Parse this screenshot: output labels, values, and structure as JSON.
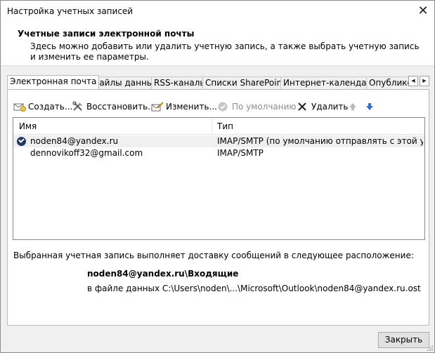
{
  "window": {
    "title": "Настройка учетных записей",
    "close_glyph": "✕"
  },
  "header": {
    "title": "Учетные записи электронной почты",
    "description": "Здесь можно добавить или удалить учетную запись, а также выбрать учетную запись и изменить ее параметры."
  },
  "tabs": [
    {
      "label": "Электронная почта",
      "active": true
    },
    {
      "label": "Файлы данных",
      "active": false
    },
    {
      "label": "RSS-каналы",
      "active": false
    },
    {
      "label": "Списки SharePoint",
      "active": false
    },
    {
      "label": "Интернет-календари",
      "active": false
    },
    {
      "label": "Опублико",
      "active": false
    }
  ],
  "toolbar": {
    "create": "Создать...",
    "restore": "Восстановить...",
    "edit": "Изменить...",
    "default": "По умолчанию",
    "delete": "Удалить"
  },
  "list": {
    "columns": {
      "name": "Имя",
      "type": "Тип"
    },
    "rows": [
      {
        "name": "noden84@yandex.ru",
        "type": "IMAP/SMTP (по умолчанию отправлять с этой уче...",
        "default": true,
        "selected": true
      },
      {
        "name": "dennovikoff32@gmail.com",
        "type": "IMAP/SMTP",
        "default": false,
        "selected": false
      }
    ]
  },
  "delivery": {
    "label": "Выбранная учетная запись выполняет доставку сообщений в следующее расположение:",
    "folder": "noden84@yandex.ru\\Входящие",
    "path": "в файле данных C:\\Users\\noden\\...\\Microsoft\\Outlook\\noden84@yandex.ru.ost"
  },
  "buttons": {
    "close": "Закрыть"
  },
  "colors": {
    "accent_blue": "#2f6fd6",
    "check_badge": "#1f3868",
    "disabled": "#8c8c8c"
  }
}
